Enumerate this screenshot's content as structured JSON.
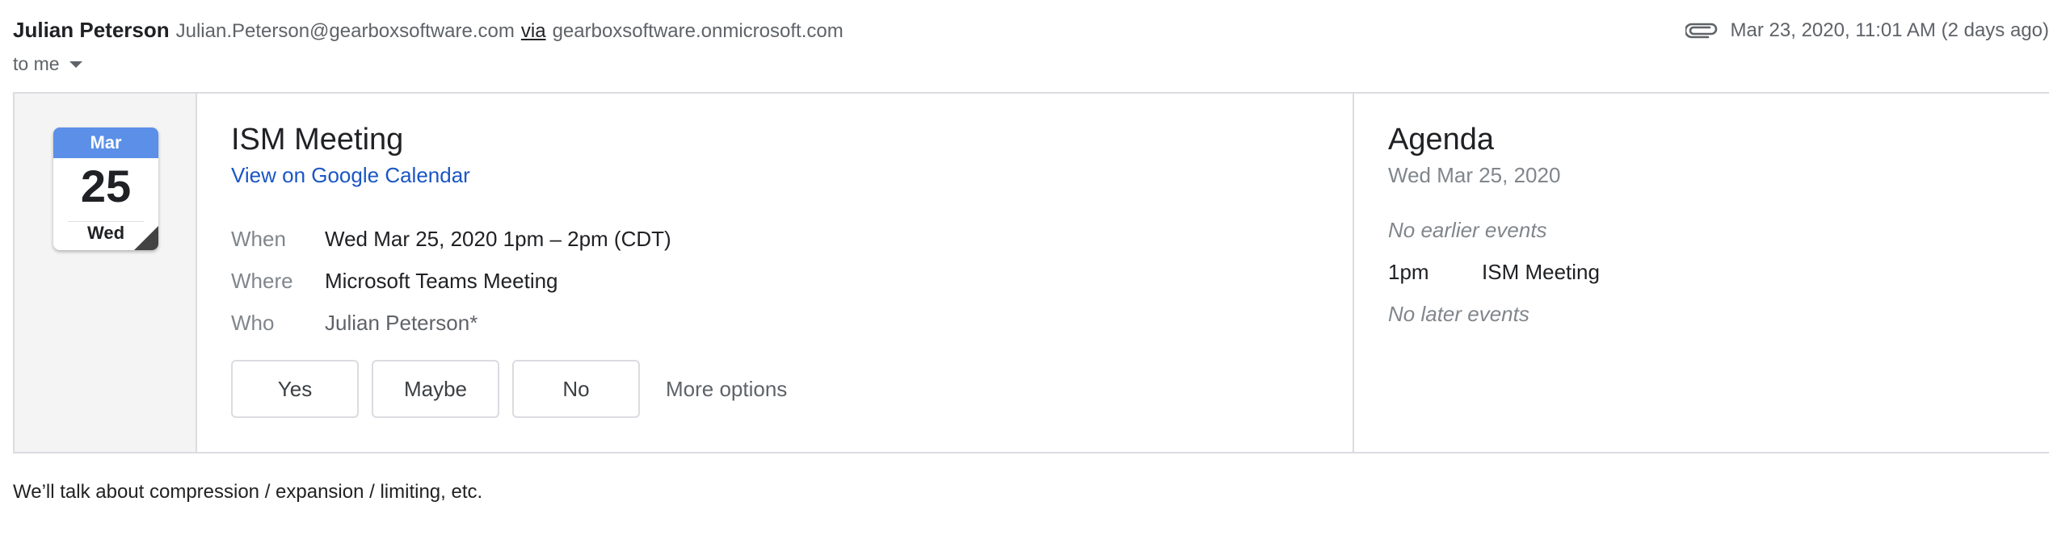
{
  "header": {
    "sender_name": "Julian Peterson",
    "sender_email": "Julian.Peterson@gearboxsoftware.com",
    "via_label": "via",
    "via_domain": "gearboxsoftware.onmicrosoft.com",
    "recipient": "to me",
    "timestamp": "Mar 23, 2020, 11:01 AM (2 days ago)",
    "attachment_icon": "paperclip-icon"
  },
  "calendar_icon": {
    "month": "Mar",
    "day": "25",
    "weekday": "Wed",
    "accent_color": "#5b8fe8"
  },
  "event": {
    "title": "ISM Meeting",
    "calendar_link": "View on Google Calendar",
    "details": [
      {
        "label": "When",
        "value": "Wed Mar 25, 2020 1pm – 2pm (CDT)"
      },
      {
        "label": "Where",
        "value": "Microsoft Teams Meeting"
      },
      {
        "label": "Who",
        "value": "Julian Peterson*"
      }
    ],
    "rsvp": {
      "yes": "Yes",
      "maybe": "Maybe",
      "no": "No",
      "more": "More options"
    }
  },
  "agenda": {
    "title": "Agenda",
    "date": "Wed Mar 25, 2020",
    "no_earlier": "No earlier events",
    "event_time": "1pm",
    "event_title": "ISM Meeting",
    "no_later": "No later events"
  },
  "message_body": "We’ll talk about compression / expansion / limiting, etc."
}
